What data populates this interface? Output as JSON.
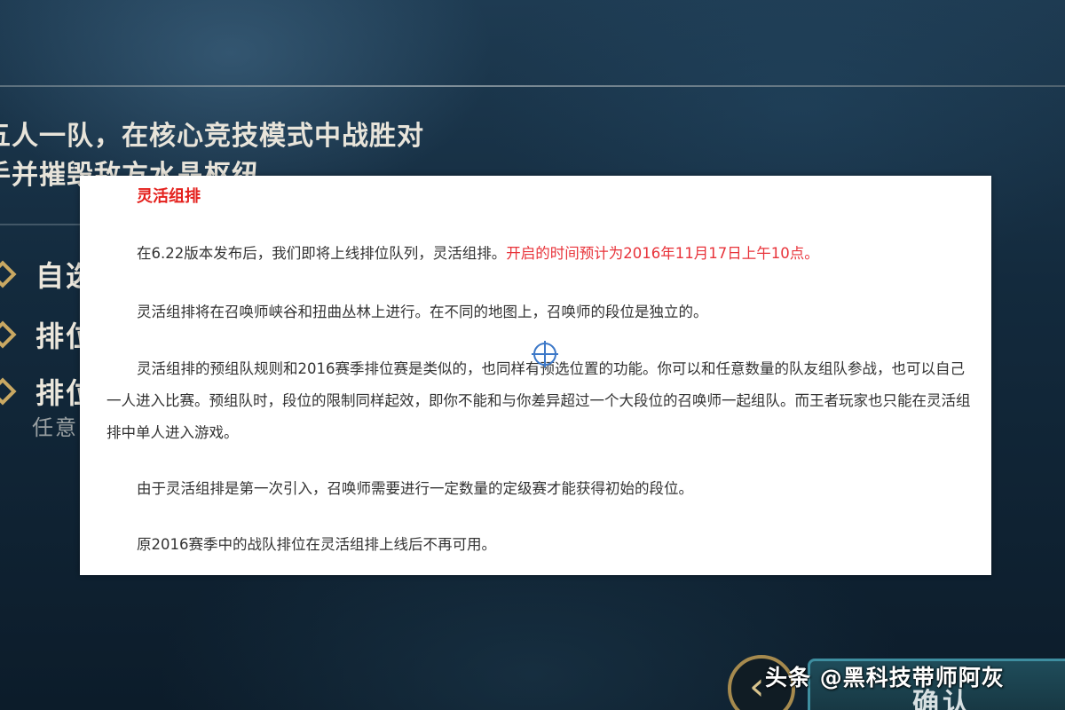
{
  "background": {
    "mode_description": "五人一队，在核心竞技模式中战胜对手并摧毁敌方水晶枢纽",
    "options": [
      {
        "label": "自选"
      },
      {
        "label": "排位"
      },
      {
        "label": "排位",
        "sub": "任意"
      }
    ],
    "confirm_label": "确认",
    "back_symbol": "‹"
  },
  "document": {
    "title": "灵活组排",
    "paragraphs": [
      {
        "text": "在6.22版本发布后，我们即将上线排位队列，灵活组排。",
        "highlight": "开启的时间预计为2016年11月17日上午10点。"
      },
      {
        "text": "灵活组排将在召唤师峡谷和扭曲丛林上进行。在不同的地图上，召唤师的段位是独立的。"
      },
      {
        "text": "灵活组排的预组队规则和2016赛季排位赛是类似的，也同样有预选位置的功能。你可以和任意数量的队友组队参战，也可以自己一人进入比赛。预组队时，段位的限制同样起效，即你不能和与你差异超过一个大段位的召唤师一起组队。而王者玩家也只能在灵活组排中单人进入游戏。"
      },
      {
        "text": "由于灵活组排是第一次引入，召唤师需要进行一定数量的定级赛才能获得初始的段位。"
      },
      {
        "text": "原2016赛季中的战队排位在灵活组排上线后不再可用。"
      }
    ]
  },
  "watermark": "头条 @黑科技带师阿灰",
  "colors": {
    "title_red": "#e4201c",
    "highlight_red": "#e8333a",
    "gold_accent": "#c9a862"
  }
}
